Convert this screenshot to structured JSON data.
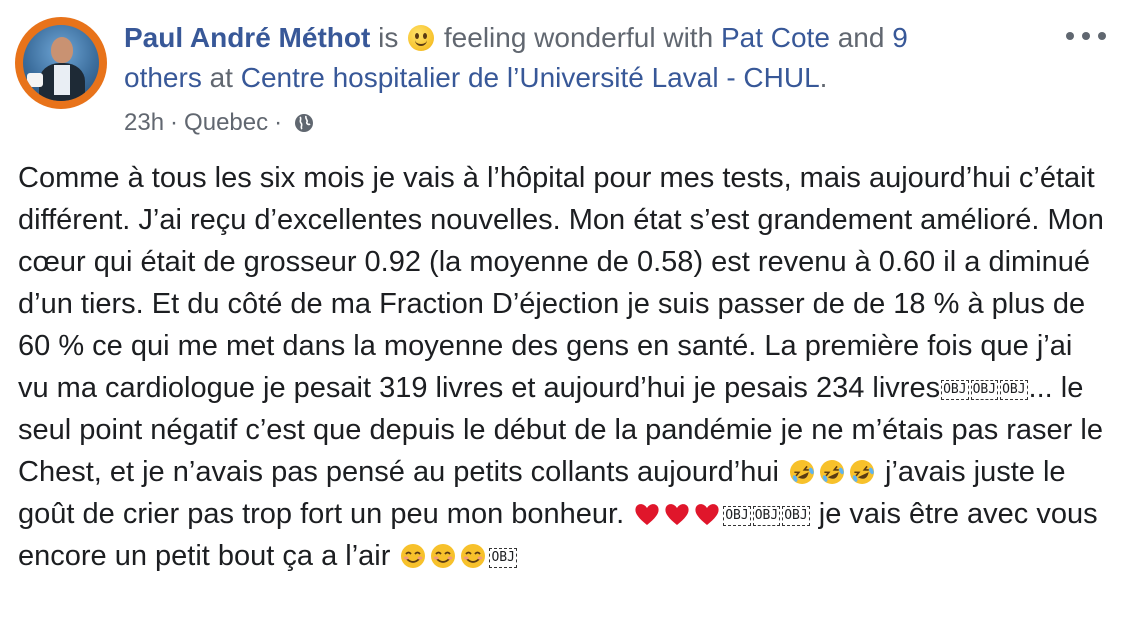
{
  "post": {
    "author": "Paul André Méthot",
    "is": "is",
    "feeling": "feeling wonderful with",
    "tagged_primary": "Pat Cote",
    "and": "and",
    "others_count": "9",
    "others_rest": "others",
    "at": "at",
    "location": "Centre hospitalier de l’Université Laval - CHUL",
    "period": ".",
    "time": "23h",
    "place": "Quebec",
    "audience_icon": "globe-icon",
    "more_icon": "more-options-icon",
    "body": {
      "seg1": "Comme à tous les six mois je vais à l’hôpital pour mes tests, mais aujourd’hui c’était différent. J’ai reçu d’excellentes nouvelles. Mon état s’est grandement amélioré. Mon cœur qui était de grosseur 0.92 (la moyenne de 0.58) est revenu à 0.60 il a diminué d’un tiers. Et du côté de ma Fraction D’éjection je suis passer de de 18 % à plus de 60 % ce qui me met dans la moyenne des gens en santé. La première fois que j’ai vu ma cardiologue je pesait 319 livres et aujourd’hui je pesais 234 livres",
      "obj": "OBJ",
      "seg2": "... le seul point négatif c’est que depuis le début de la pandémie je ne m’étais pas raser le Chest, et je n’avais pas pensé au petits collants aujourd’hui ",
      "seg3": " j’avais juste le goût de crier pas trop fort un peu mon bonheur. ",
      "seg4": " je vais être avec vous encore un petit bout ça a l’air ",
      "emoji_laugh": "rolling-on-floor-laughing-icon",
      "emoji_heart": "red-heart-icon",
      "emoji_blush": "smiling-face-icon"
    }
  },
  "colors": {
    "link": "#385898",
    "meta": "#616770",
    "text": "#1c1e21",
    "avatar_ring": "#e8731a"
  }
}
